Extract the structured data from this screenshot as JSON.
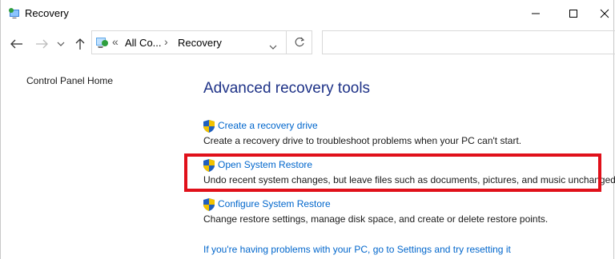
{
  "window": {
    "title": "Recovery"
  },
  "nav": {
    "breadcrumb": [
      "All Co...",
      "Recovery"
    ],
    "search_placeholder": ""
  },
  "sidebar": {
    "items": [
      {
        "label": "Control Panel Home"
      }
    ]
  },
  "main": {
    "title": "Advanced recovery tools",
    "items": [
      {
        "link": "Create a recovery drive",
        "description": "Create a recovery drive to troubleshoot problems when your PC can't start.",
        "icon": "uac-shield-icon"
      },
      {
        "link": "Open System Restore",
        "description": "Undo recent system changes, but leave files such as documents, pictures, and music unchanged.",
        "icon": "uac-shield-icon",
        "highlighted": true
      },
      {
        "link": "Configure System Restore",
        "description": "Change restore settings, manage disk space, and create or delete restore points.",
        "icon": "uac-shield-icon"
      }
    ],
    "bottom_link": "If you're having problems with your PC, go to Settings and try resetting it"
  },
  "colors": {
    "link": "#0066cc",
    "title": "#1e3287",
    "highlight": "#e0101a"
  }
}
